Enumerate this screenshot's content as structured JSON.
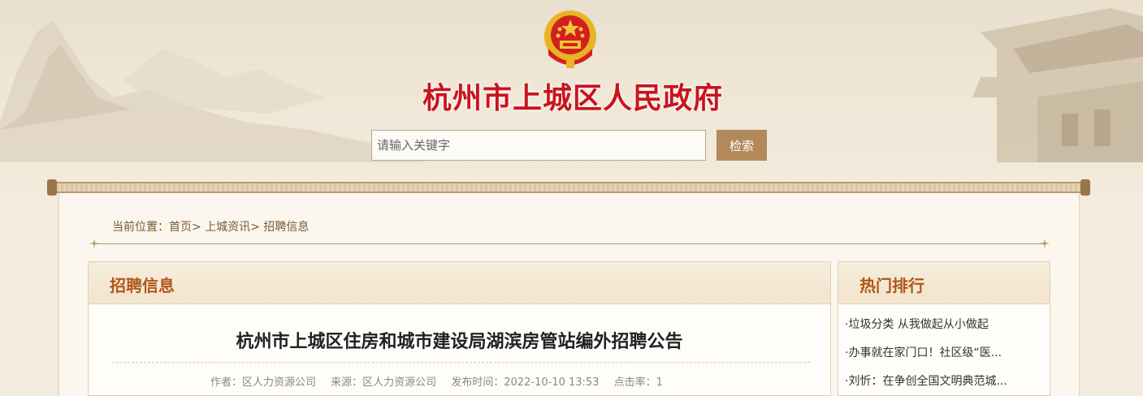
{
  "header": {
    "site_title": "杭州市上城区人民政府",
    "emblem_icon": "national-emblem-icon"
  },
  "search": {
    "placeholder": "请输入关键字",
    "button_label": "检索"
  },
  "breadcrumb": {
    "prefix": "当前位置：",
    "items": [
      "首页",
      "上城资讯",
      "招聘信息"
    ],
    "separator": ">"
  },
  "main": {
    "section_title": "招聘信息",
    "article": {
      "title": "杭州市上城区住房和城市建设局湖滨房管站编外招聘公告",
      "author": "作者：区人力资源公司",
      "source": "来源：区人力资源公司",
      "published": "发布时间：2022-10-10 13:53",
      "clicks": "点击率：1"
    }
  },
  "sidebar": {
    "title": "热门排行",
    "items": [
      "·垃圾分类 从我做起从小做起",
      "·办事就在家门口！社区级“医...",
      "·刘忻：在争创全国文明典范城..."
    ]
  },
  "colors": {
    "title_red": "#c9141d",
    "search_button": "#b1895a",
    "section_heading": "#b0561a",
    "background": "#f3ebdd"
  }
}
